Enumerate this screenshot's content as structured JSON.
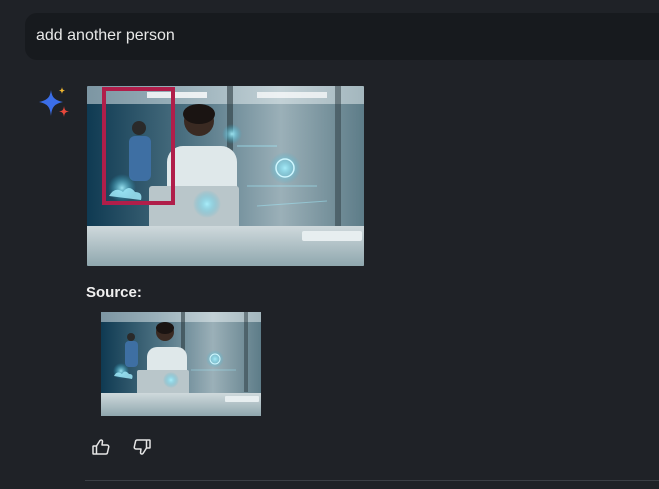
{
  "prompt": {
    "text": "add another person"
  },
  "response": {
    "source_label": "Source:"
  },
  "icons": {
    "assistant": "sparkle-icon",
    "like": "thumbs-up-icon",
    "dislike": "thumbs-down-icon"
  },
  "colors": {
    "background": "#1f2227",
    "prompt_bar": "#171a1e",
    "highlight_box": "#b01e4a",
    "sparkle_blue": "#3b6ee8",
    "sparkle_red": "#e8483b",
    "sparkle_yellow": "#f2b830"
  }
}
